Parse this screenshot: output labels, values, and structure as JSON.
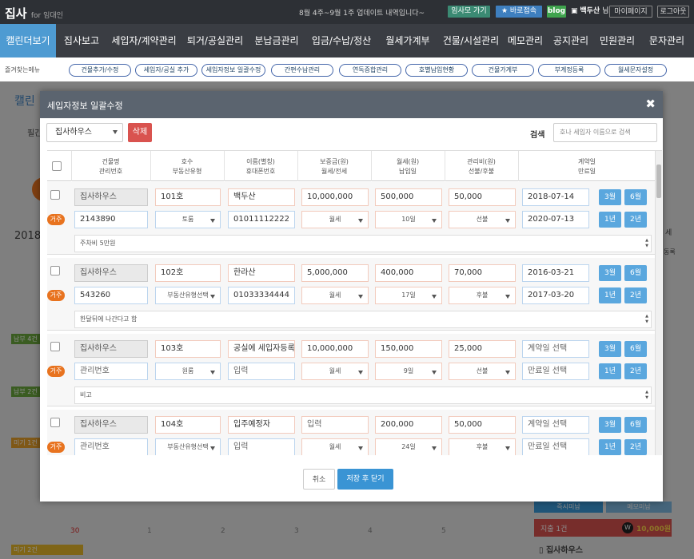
{
  "app": {
    "logo": "집사",
    "logo_sub": "for 임대인",
    "notice": "8월 4주~9월 1주 업데이트 내역입니다~",
    "btn_site": "임사모 가기",
    "btn_remote": "바로접속",
    "btn_blog": "blog",
    "user": "백두산",
    "user_suffix": "님",
    "btn_mypage": "마이페이지",
    "btn_logout": "로그아웃"
  },
  "nav": {
    "items": [
      "캘린더보기",
      "집사보고",
      "세입자/계약관리",
      "퇴거/공실관리",
      "분납금관리",
      "입금/수납/정산",
      "월세가계부",
      "건물/시설관리",
      "메모관리",
      "공지관리",
      "민원관리",
      "문자관리"
    ],
    "active_index": 0
  },
  "quick": {
    "label": "즐겨찾는메뉴",
    "items": [
      "건물추가/수정",
      "세입자/공실 추가",
      "세입자정보 일괄수정",
      "간편수납관리",
      "연독증합관리",
      "호별납입현황",
      "건물가계부",
      "부계정등록",
      "월세문자설정"
    ]
  },
  "background": {
    "cal_title": "캘린",
    "filter": "필간",
    "year": "2018",
    "side_btn_1": "즉시미납",
    "side_btn_2": "메모미납",
    "expense_label": "지출 1건",
    "expense_amount": "10,000원",
    "expense_badge": "W",
    "house_label": "집사하우스",
    "day_30": "30",
    "days": [
      "1",
      "2",
      "3",
      "4",
      "5"
    ],
    "left_badges": [
      "납부 4건",
      "납부 2건",
      "미기 1건",
      "미기 2건"
    ],
    "side_cut": [
      "세",
      "동록"
    ]
  },
  "modal": {
    "title": "세입자정보 일괄수정",
    "close": "✖",
    "building_select": "집사하우스",
    "delete_btn": "삭제",
    "search_label": "검색",
    "search_placeholder": "호나 세입자 이름으로 검색",
    "headers": [
      [
        "건물명",
        "관리번호"
      ],
      [
        "호수",
        "부동산유형"
      ],
      [
        "이름(별칭)",
        "휴대폰번호"
      ],
      [
        "보증금(원)",
        "월세/전세"
      ],
      [
        "월세(원)",
        "납입일"
      ],
      [
        "관리비(원)",
        "선불/후불"
      ],
      [
        "계약일",
        "만료일"
      ]
    ],
    "rows": [
      {
        "tag": "거주",
        "building": "집사하우스",
        "unit": "101호",
        "name": "백두산",
        "deposit": "10,000,000",
        "rent": "500,000",
        "fee": "50,000",
        "start": "2018-07-14",
        "mgmt_no": "2143890",
        "type": "토룸",
        "phone": "01011112222",
        "rent_type": "월세",
        "pay_day": "10일",
        "fee_type": "선불",
        "end": "2020-07-13",
        "memo": "주차비 5만원",
        "btns": [
          "3월",
          "6월",
          "1년",
          "2년"
        ]
      },
      {
        "tag": "거주",
        "building": "집사하우스",
        "unit": "102호",
        "name": "한라산",
        "deposit": "5,000,000",
        "rent": "400,000",
        "fee": "70,000",
        "start": "2016-03-21",
        "mgmt_no": "543260",
        "type": "부동산유형선택",
        "phone": "01033334444",
        "rent_type": "월세",
        "pay_day": "17일",
        "fee_type": "후불",
        "end": "2017-03-20",
        "memo": "한달뒤에 나간다고 함",
        "btns": [
          "3월",
          "6월",
          "1년",
          "2년"
        ]
      },
      {
        "tag": "거주",
        "building": "집사하우스",
        "unit": "103호",
        "name": "공실에 세입자등록",
        "deposit": "10,000,000",
        "rent": "150,000",
        "fee": "25,000",
        "start": "계약일 선택",
        "mgmt_no": "관리번호",
        "type": "원룸",
        "phone": "입력",
        "rent_type": "월세",
        "pay_day": "9일",
        "fee_type": "선불",
        "end": "만료일 선택",
        "memo": "비고",
        "btns": [
          "3월",
          "6월",
          "1년",
          "2년"
        ]
      },
      {
        "tag": "거주",
        "building": "집사하우스",
        "unit": "104호",
        "name": "입주예정자",
        "deposit": "입력",
        "rent": "200,000",
        "fee": "50,000",
        "start": "계약일 선택",
        "mgmt_no": "관리번호",
        "type": "부동산유형선택",
        "phone": "입력",
        "rent_type": "월세",
        "pay_day": "24일",
        "fee_type": "후불",
        "end": "만료일 선택",
        "memo": "",
        "btns": [
          "3월",
          "6월",
          "1년",
          "2년"
        ]
      }
    ],
    "cancel_btn": "취소",
    "save_btn": "저장 후 닫기"
  }
}
